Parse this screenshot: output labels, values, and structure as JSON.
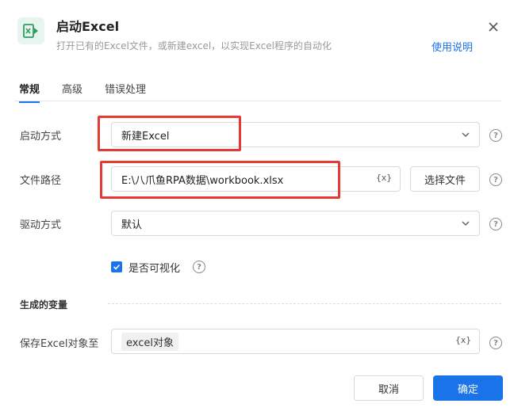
{
  "header": {
    "icon": "excel-launch-icon",
    "title": "启动Excel",
    "subtitle": "打开已有的Excel文件，或新建excel，以实现Excel程序的自动化",
    "help_link": "使用说明",
    "close_icon": "close-icon"
  },
  "tabs": [
    {
      "label": "常规",
      "active": true
    },
    {
      "label": "高级",
      "active": false
    },
    {
      "label": "错误处理",
      "active": false
    }
  ],
  "form": {
    "launch_mode": {
      "label": "启动方式",
      "value": "新建Excel"
    },
    "file_path": {
      "label": "文件路径",
      "value": "E:\\八爪鱼RPA数据\\workbook.xlsx",
      "var_icon": "{x}",
      "select_button": "选择文件"
    },
    "driver_mode": {
      "label": "驱动方式",
      "value": "默认"
    },
    "visible": {
      "label": "是否可视化",
      "checked": true
    }
  },
  "output": {
    "section_title": "生成的变量",
    "save_label": "保存Excel对象至",
    "variable": "excel对象",
    "var_icon": "{x}"
  },
  "footer": {
    "cancel": "取消",
    "ok": "确定"
  },
  "colors": {
    "accent": "#1a73e8",
    "highlight": "#e53935",
    "icon_green": "#2e9e5b"
  }
}
